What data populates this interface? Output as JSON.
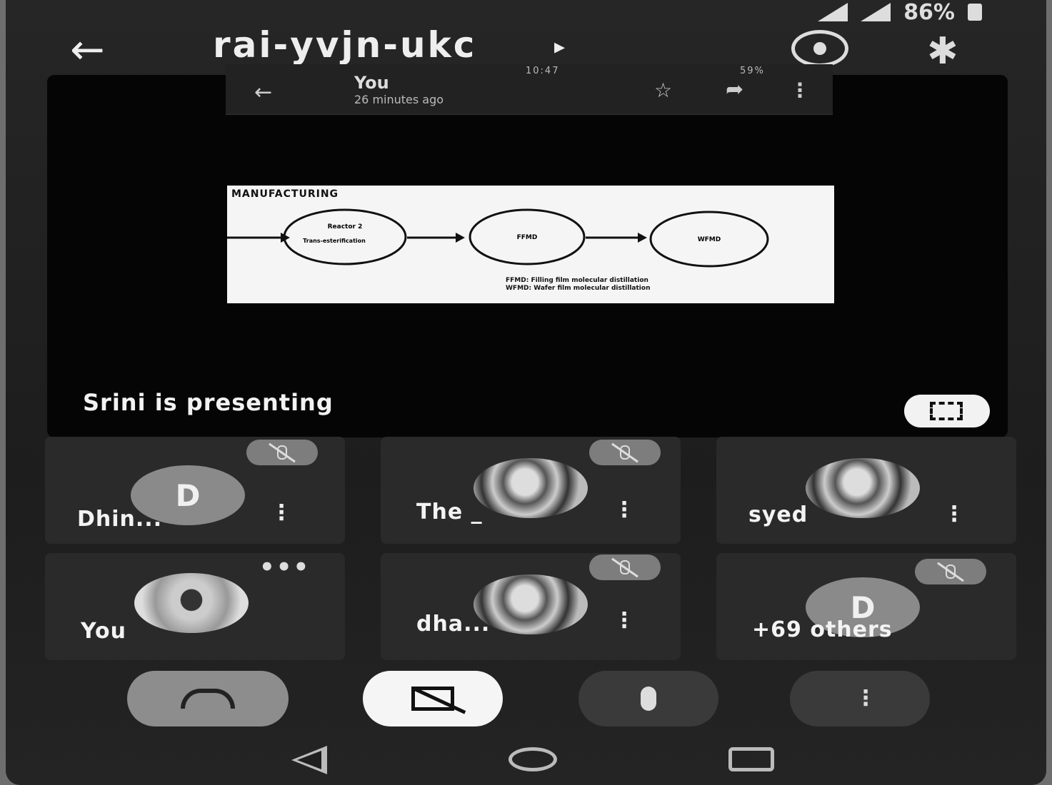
{
  "status_bar": {
    "battery": "86%"
  },
  "app_bar": {
    "meeting_code": "rai-yvjn-ukc",
    "chevron": "▸",
    "back_icon": "back-arrow-icon",
    "switch_camera_icon": "switch-camera-icon",
    "bluetooth_icon": "bluetooth-icon"
  },
  "shared_screen": {
    "status_time": "10:47",
    "status_battery": "59%",
    "title": "You",
    "subtitle": "26 minutes ago",
    "slide": {
      "heading": "MANUFACTURING",
      "stages": [
        "Reactor 2",
        "Trans-esterification",
        "FFMD",
        "WFMD"
      ],
      "legend": [
        "FFMD: Filling film molecular distillation",
        "WFMD: Wafer film molecular distillation"
      ]
    }
  },
  "presenter_text": "Srini is presenting",
  "participants": [
    {
      "name": "Dhin...",
      "avatar": "D",
      "muted": true
    },
    {
      "name": "The _",
      "avatar": "",
      "muted": true
    },
    {
      "name": "syed",
      "avatar": "",
      "muted": false
    },
    {
      "name": "You",
      "avatar": "",
      "muted": false,
      "more": "•••"
    },
    {
      "name": "dha...",
      "avatar": "",
      "muted": true
    },
    {
      "name": "+69 others",
      "avatar": "D",
      "muted": true
    }
  ],
  "controls": {
    "end_call_icon": "end-call-icon",
    "camera_icon": "camera-off-icon",
    "mic_icon": "mic-icon",
    "more_icon": "more-vert-icon"
  },
  "colors": {
    "background": "#1f1f1f",
    "tile": "#2a2a2a",
    "control_light": "#f5f5f5"
  }
}
